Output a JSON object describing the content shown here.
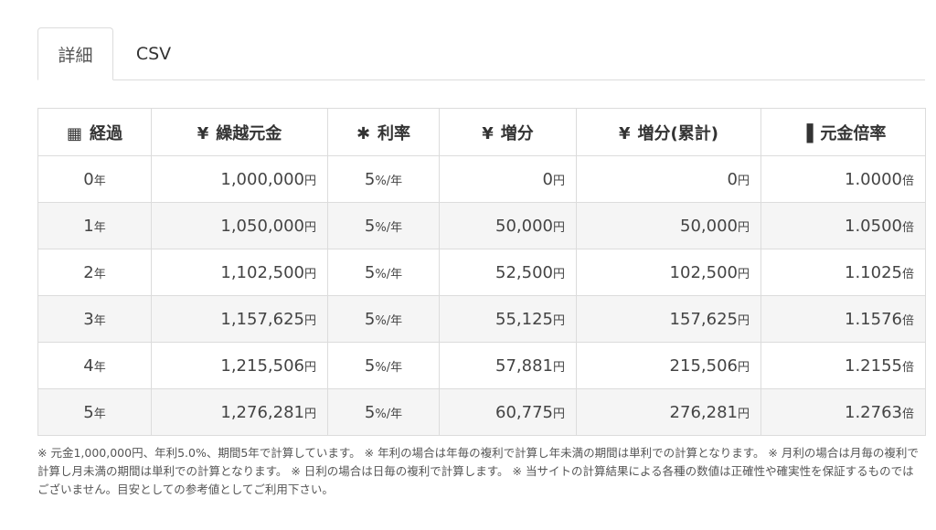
{
  "tabs": [
    {
      "label": "詳細"
    },
    {
      "label": "CSV"
    }
  ],
  "table": {
    "headers": [
      {
        "icon": "calendar-icon",
        "glyph": "▦",
        "label": "経過"
      },
      {
        "icon": "yen-icon",
        "glyph": "¥",
        "label": "繰越元金"
      },
      {
        "icon": "asterisk-icon",
        "glyph": "✱",
        "label": "利率"
      },
      {
        "icon": "yen-icon",
        "glyph": "¥",
        "label": "増分"
      },
      {
        "icon": "yen-icon",
        "glyph": "¥",
        "label": "増分(累計)"
      },
      {
        "icon": "bar-chart-icon",
        "glyph": "▐",
        "label": "元金倍率"
      }
    ],
    "units": {
      "year": "年",
      "yen": "円",
      "rate": "%/年",
      "ratio": "倍"
    },
    "rows": [
      {
        "year": "0",
        "principal": "1,000,000",
        "rate": "5",
        "increment": "0",
        "cumulative": "0",
        "ratio": "1.0000"
      },
      {
        "year": "1",
        "principal": "1,050,000",
        "rate": "5",
        "increment": "50,000",
        "cumulative": "50,000",
        "ratio": "1.0500"
      },
      {
        "year": "2",
        "principal": "1,102,500",
        "rate": "5",
        "increment": "52,500",
        "cumulative": "102,500",
        "ratio": "1.1025"
      },
      {
        "year": "3",
        "principal": "1,157,625",
        "rate": "5",
        "increment": "55,125",
        "cumulative": "157,625",
        "ratio": "1.1576"
      },
      {
        "year": "4",
        "principal": "1,215,506",
        "rate": "5",
        "increment": "57,881",
        "cumulative": "215,506",
        "ratio": "1.2155"
      },
      {
        "year": "5",
        "principal": "1,276,281",
        "rate": "5",
        "increment": "60,775",
        "cumulative": "276,281",
        "ratio": "1.2763"
      }
    ]
  },
  "notes": "※ 元金1,000,000円、年利5.0%、期間5年で計算しています。 ※ 年利の場合は年毎の複利で計算し年未満の期間は単利での計算となります。 ※ 月利の場合は月毎の複利で計算し月未満の期間は単利での計算となります。 ※ 日利の場合は日毎の複利で計算します。 ※ 当サイトの計算結果による各種の数値は正確性や確実性を保証するものではございません。目安としての参考値としてご利用下さい。"
}
